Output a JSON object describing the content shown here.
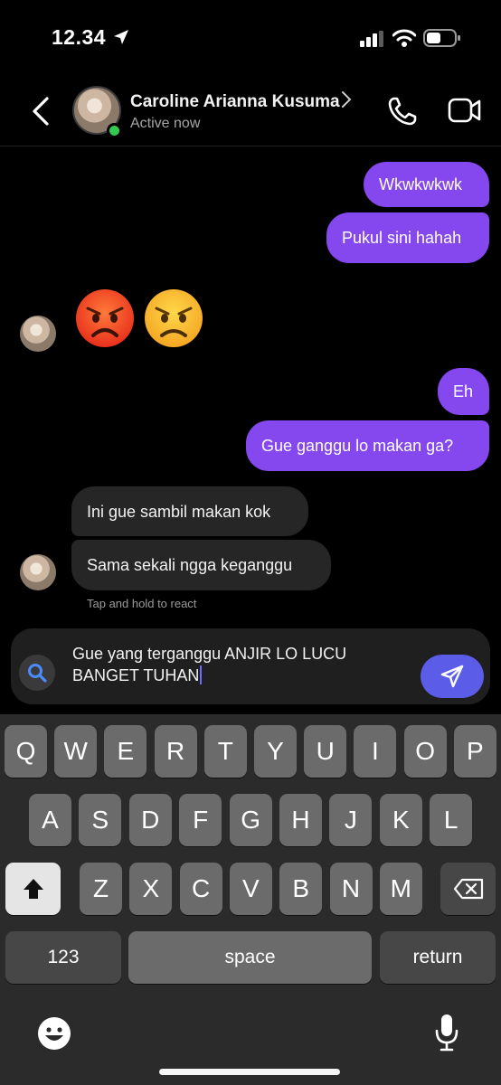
{
  "status_bar": {
    "time": "12.34"
  },
  "header": {
    "contact_name": "Caroline Arianna Kusuma",
    "contact_status": "Active now"
  },
  "messages": [
    {
      "side": "outgoing",
      "text": "Wkwkwkwk"
    },
    {
      "side": "outgoing",
      "text": "Pukul sini hahah"
    },
    {
      "side": "incoming",
      "type": "emoji",
      "emojis": [
        "pouting-face",
        "angry-face"
      ]
    },
    {
      "side": "outgoing",
      "text": "Eh"
    },
    {
      "side": "outgoing",
      "text": "Gue ganggu lo makan ga?"
    },
    {
      "side": "incoming",
      "text": "Ini gue sambil makan kok"
    },
    {
      "side": "incoming",
      "text": "Sama sekali ngga keganggu"
    }
  ],
  "react_hint": "Tap and hold to react",
  "composer": {
    "value": "Gue yang terganggu ANJIR LO LUCU BANGET TUHAN"
  },
  "keyboard": {
    "row1": [
      "Q",
      "W",
      "E",
      "R",
      "T",
      "Y",
      "U",
      "I",
      "O",
      "P"
    ],
    "row2": [
      "A",
      "S",
      "D",
      "F",
      "G",
      "H",
      "J",
      "K",
      "L"
    ],
    "row3": [
      "Z",
      "X",
      "C",
      "V",
      "B",
      "N",
      "M"
    ],
    "numbers_key": "123",
    "space_key": "space",
    "return_key": "return"
  },
  "colors": {
    "outgoing_bubble": "#8547ee",
    "incoming_bubble": "#262626",
    "send_button": "#5b5ce7",
    "online_indicator": "#31c94e"
  }
}
